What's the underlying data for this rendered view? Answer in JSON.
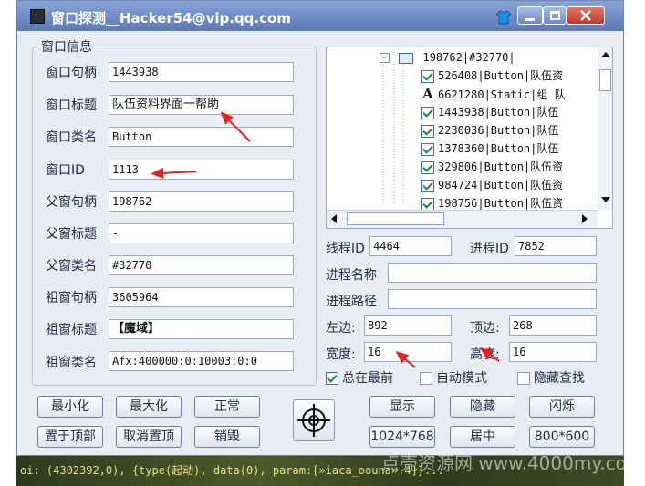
{
  "window": {
    "title": "窗口探测__Hacker54@vip.qq.com"
  },
  "info_group": {
    "title": "窗口信息",
    "fields": [
      {
        "label": "窗口句柄",
        "value": "1443938"
      },
      {
        "label": "窗口标题",
        "value": "队伍资料界面一帮助"
      },
      {
        "label": "窗口类名",
        "value": "Button"
      },
      {
        "label": "窗口ID",
        "value": "1113"
      },
      {
        "label": "父窗句柄",
        "value": "198762"
      },
      {
        "label": "父窗标题",
        "value": "-"
      },
      {
        "label": "父窗类名",
        "value": "#32770"
      },
      {
        "label": "祖窗句柄",
        "value": "3605964"
      },
      {
        "label": "祖窗标题",
        "value": "【魔域】"
      },
      {
        "label": "祖窗类名",
        "value": "Afx:400000:0:10003:0:0"
      }
    ]
  },
  "tree": {
    "root": "198762|#32770|",
    "items": [
      {
        "kind": "check",
        "text": "526408|Button|队伍资"
      },
      {
        "kind": "static",
        "text": "6621280|Static|组 队"
      },
      {
        "kind": "check",
        "text": "1443938|Button|队伍"
      },
      {
        "kind": "check",
        "text": "2230036|Button|队伍"
      },
      {
        "kind": "check",
        "text": "1378360|Button|队伍"
      },
      {
        "kind": "check",
        "text": "329806|Button|队伍资"
      },
      {
        "kind": "check",
        "text": "984724|Button|队伍资"
      },
      {
        "kind": "check",
        "text": "198756|Button|队伍资"
      }
    ]
  },
  "process": {
    "thread_id_label": "线程ID",
    "thread_id": "4464",
    "process_id_label": "进程ID",
    "process_id": "7852",
    "name_label": "进程名称",
    "name": "",
    "path_label": "进程路径",
    "path": ""
  },
  "geometry": {
    "left_label": "左边:",
    "left": "892",
    "top_label": "顶边:",
    "top": "268",
    "width_label": "宽度:",
    "width": "16",
    "height_label": "高度:",
    "height": "16"
  },
  "options": {
    "always_on_top": {
      "label": "总在最前",
      "checked": true
    },
    "auto_mode": {
      "label": "自动模式",
      "checked": false
    },
    "hide_search": {
      "label": "隐藏查找",
      "checked": false
    }
  },
  "buttons": {
    "minimize": "最小化",
    "maximize": "最大化",
    "normal": "正常",
    "show": "显示",
    "hide": "隐藏",
    "flash": "闪烁",
    "topmost": "置于顶部",
    "untop": "取消置顶",
    "destroy": "销毁",
    "res_1024": "1024*768",
    "center": "居中",
    "res_800": "800*600"
  },
  "background_text": "oi: (4302392,0), {type(起动), data(0), param:[»iaca_oouna».4]}...",
  "watermark": "点壳资源网 www.4000my.com"
}
